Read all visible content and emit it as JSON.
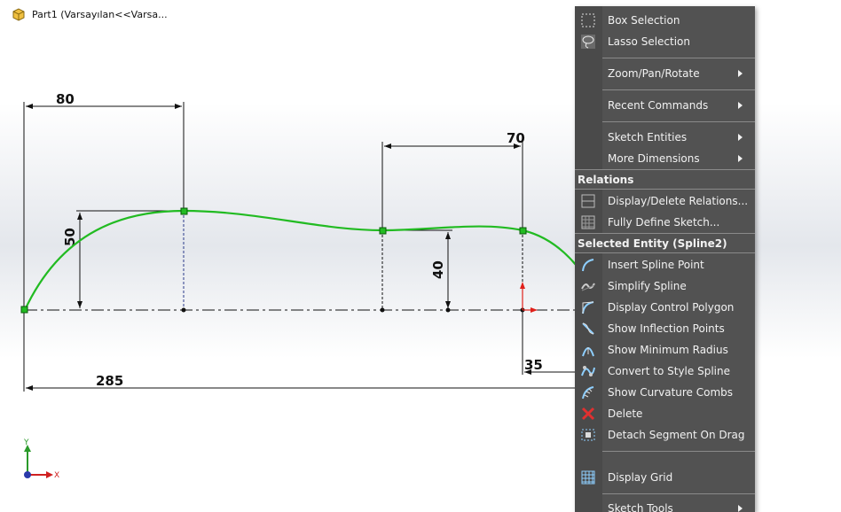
{
  "window": {
    "title": "Part1  (Varsayılan<<Varsa..."
  },
  "dimensions": {
    "d80": "80",
    "d70": "70",
    "d50": "50",
    "d40": "40",
    "d35": "35",
    "d285": "285"
  },
  "axes": {
    "y": "Y",
    "x": "X"
  },
  "context_menu": {
    "items": [
      {
        "label": "Box Selection",
        "icon": "box-selection-icon"
      },
      {
        "label": "Lasso Selection",
        "icon": "lasso-selection-icon"
      },
      {
        "label": "Zoom/Pan/Rotate",
        "submenu": true
      },
      {
        "label": "Recent Commands",
        "submenu": true
      },
      {
        "label": "Sketch Entities",
        "submenu": true
      },
      {
        "label": "More Dimensions",
        "submenu": true
      }
    ],
    "relations_header": "Relations",
    "relations": [
      {
        "label": "Display/Delete Relations...",
        "icon": "relations-icon"
      },
      {
        "label": "Fully Define Sketch...",
        "icon": "fully-define-icon"
      }
    ],
    "entity_header": "Selected Entity (Spline2)",
    "entity_items": [
      {
        "label": "Insert Spline Point",
        "icon": "insert-spline-point-icon"
      },
      {
        "label": "Simplify Spline",
        "icon": "simplify-spline-icon"
      },
      {
        "label": "Display Control Polygon",
        "icon": "control-polygon-icon"
      },
      {
        "label": "Show Inflection Points",
        "icon": "inflection-icon"
      },
      {
        "label": "Show Minimum Radius",
        "icon": "minimum-radius-icon"
      },
      {
        "label": "Convert to Style Spline",
        "icon": "style-spline-icon"
      },
      {
        "label": "Show Curvature Combs",
        "icon": "curvature-combs-icon"
      },
      {
        "label": "Delete",
        "icon": "delete-icon"
      },
      {
        "label": "Detach Segment On Drag",
        "icon": "detach-segment-icon"
      }
    ],
    "display_grid": {
      "label": "Display Grid",
      "icon": "grid-icon"
    },
    "sketch_tools": {
      "label": "Sketch Tools",
      "submenu": true
    }
  },
  "colors": {
    "menu_bg": "#525252",
    "spline": "#22bb22",
    "dimension": "#111111",
    "accent_red": "#e0201a"
  }
}
